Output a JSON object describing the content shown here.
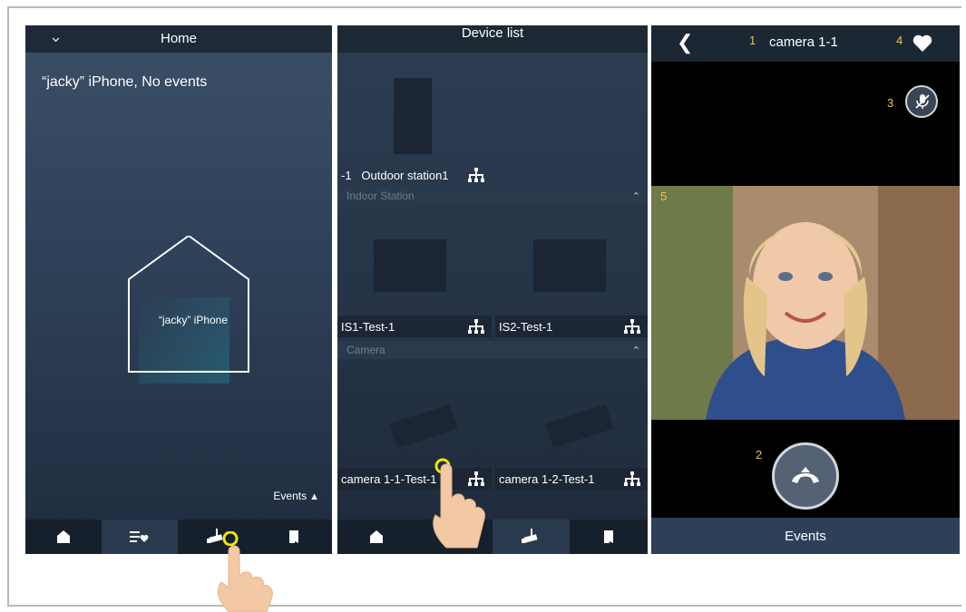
{
  "home": {
    "title": "Home",
    "message": "“jacky” iPhone, No events",
    "house_label": "“jacky” iPhone",
    "events_label": "Events"
  },
  "device_list": {
    "title": "Device list",
    "outdoor_prefix": "-1",
    "outdoor_label": "Outdoor station1",
    "sections": {
      "indoor": "Indoor Station",
      "camera": "Camera"
    },
    "indoor_items": [
      "IS1-Test-1",
      "IS2-Test-1"
    ],
    "camera_items": [
      "camera 1-1-Test-1",
      "camera 1-2-Test-1"
    ]
  },
  "camera_view": {
    "title": "camera 1-1",
    "events_label": "Events",
    "callouts": {
      "title": "1",
      "hangup": "2",
      "mute": "3",
      "favorite": "4",
      "video": "5"
    }
  },
  "icons": {
    "tabs": [
      "home-icon",
      "favorites-list-icon",
      "camera-icon",
      "door-icon"
    ],
    "network": "network-icon",
    "back": "chevron-left-icon",
    "favorite": "heart-icon",
    "mute": "mic-off-icon",
    "hangup": "hang-up-icon"
  },
  "colors": {
    "callout": "#e8c54a",
    "highlight_ring": "#f3e600",
    "bar": "#1c2734",
    "house_line": "#ffffff"
  }
}
